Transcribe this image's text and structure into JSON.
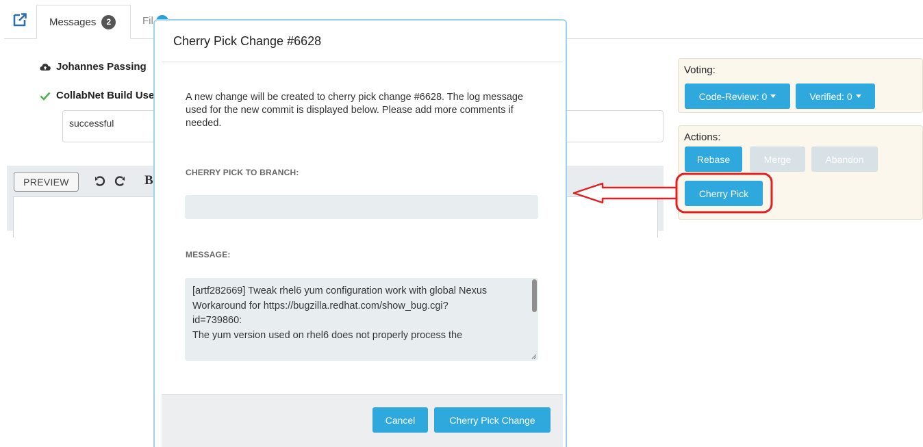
{
  "tabs": {
    "messages_label": "Messages",
    "messages_count": "2",
    "files_label": "Fil"
  },
  "comments": [
    {
      "author": "Johannes Passing",
      "icon": "cloud-upload-icon"
    },
    {
      "author": "CollabNet Build Use",
      "icon": "check-icon"
    }
  ],
  "comment_text": "successful",
  "editor": {
    "preview_label": "PREVIEW",
    "undo_icon": "undo-icon",
    "redo_icon": "redo-icon",
    "bold_label": "B"
  },
  "voting": {
    "title": "Voting:",
    "code_review_label": "Code-Review: 0",
    "verified_label": "Verified: 0"
  },
  "actions": {
    "title": "Actions:",
    "rebase_label": "Rebase",
    "merge_label": "Merge",
    "abandon_label": "Abandon",
    "cherry_pick_label": "Cherry Pick"
  },
  "modal": {
    "title": "Cherry Pick Change #6628",
    "description": "A new change will be created to cherry pick change #6628. The log message used for the new commit is displayed below. Please add more comments if needed.",
    "branch_label": "CHERRY PICK TO BRANCH:",
    "branch_value": "",
    "message_label": "MESSAGE:",
    "message_lines": [
      "[artf282669] Tweak rhel6 yum configuration work with global Nexus",
      "",
      "Workaround for https://bugzilla.redhat.com/show_bug.cgi?",
      "id=739860:",
      "The yum version used on rhel6 does not properly process the"
    ],
    "cancel_label": "Cancel",
    "confirm_label": "Cherry Pick Change"
  },
  "colors": {
    "primary": "#2ea8dd",
    "disabled": "#d8e2e6",
    "annotation": "#e02020",
    "panel_bg": "#fbf7ec"
  }
}
